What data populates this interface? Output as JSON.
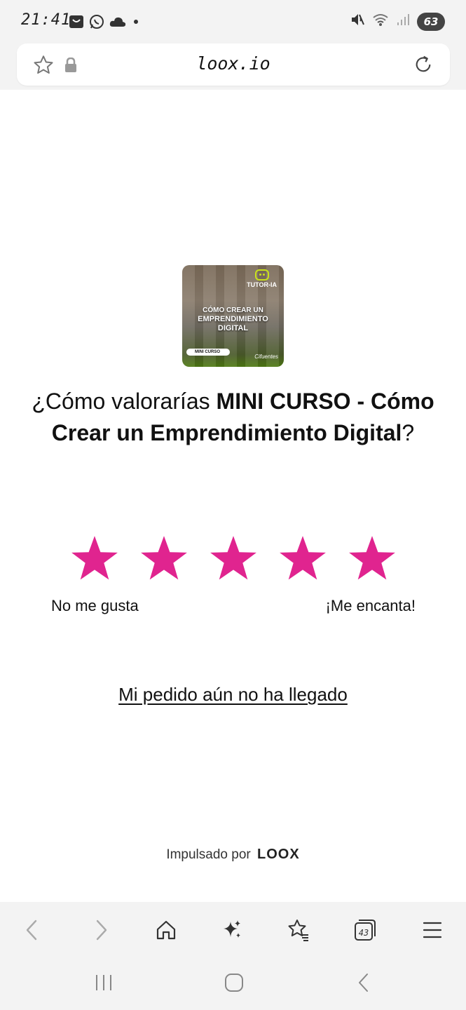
{
  "status_bar": {
    "time": "21:41",
    "battery": "63",
    "icons": [
      "shopping-bag-icon",
      "whatsapp-icon",
      "cloud-icon",
      "dot-icon",
      "mute-icon",
      "wifi-icon",
      "signal-icon",
      "battery-icon"
    ]
  },
  "address_bar": {
    "url": "loox.io",
    "icons": [
      "star-icon",
      "lock-icon",
      "reload-icon"
    ]
  },
  "product": {
    "thumbnail": {
      "brand": "TUTOR-IA",
      "title_line1": "CÓMO CREAR UN",
      "title_line2": "EMPRENDIMIENTO",
      "title_line3": "DIGITAL",
      "pill": "MINI CURSO",
      "signature": "Cifuentes"
    }
  },
  "question": {
    "prefix": "¿Cómo valorarías ",
    "product_name": "MINI CURSO - Cómo Crear un Emprendimiento Digital",
    "suffix": "?"
  },
  "rating": {
    "max": 5,
    "selected": 5,
    "star_color": "#e0248f",
    "label_low": "No me gusta",
    "label_high": "¡Me encanta!"
  },
  "links": {
    "not_arrived": "Mi pedido aún no ha llegado"
  },
  "footer": {
    "powered_by": "Impulsado por",
    "brand": "LOOX"
  },
  "toolbar": {
    "tabs_count": "43",
    "buttons": [
      "back-icon",
      "forward-icon",
      "home-icon",
      "sparkle-icon",
      "bookmarks-icon",
      "tabs-icon",
      "menu-icon"
    ]
  },
  "nav_bar": {
    "buttons": [
      "recent-apps-icon",
      "home-circle-icon",
      "back-nav-icon"
    ]
  }
}
